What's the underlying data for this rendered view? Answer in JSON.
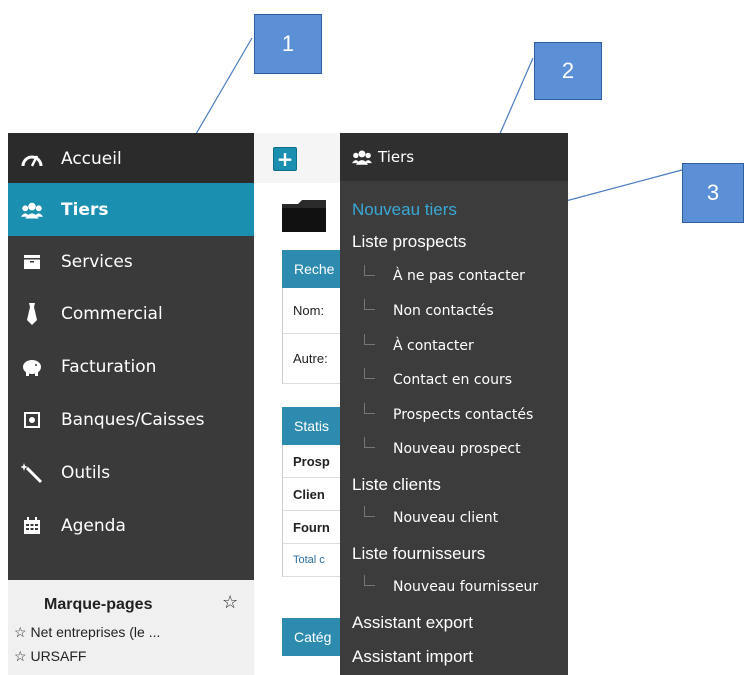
{
  "callouts": [
    "1",
    "2",
    "3"
  ],
  "sidebar": {
    "home": "Accueil",
    "items": [
      {
        "label": "Tiers",
        "icon": "users-icon",
        "active": true
      },
      {
        "label": "Services",
        "icon": "box-icon"
      },
      {
        "label": "Commercial",
        "icon": "tie-icon"
      },
      {
        "label": "Facturation",
        "icon": "piggy-bank-icon"
      },
      {
        "label": "Banques/Caisses",
        "icon": "safe-icon"
      },
      {
        "label": "Outils",
        "icon": "magic-wand-icon"
      },
      {
        "label": "Agenda",
        "icon": "calendar-icon"
      }
    ]
  },
  "bookmarks": {
    "title": "Marque-pages",
    "items": [
      "Net entreprises (le ...",
      "URSAFF"
    ]
  },
  "main": {
    "plus": "+",
    "search_head": "Reche",
    "row_nom": "Nom:",
    "row_autre": "Autre:",
    "stats_head": "Statis",
    "stats_rows": [
      "Prosp",
      "Clien",
      "Fourn",
      "Total c"
    ],
    "cat_head": "Catég"
  },
  "dropdown": {
    "header": "Tiers",
    "new_tiers": "Nouveau tiers",
    "prospects": "Liste prospects",
    "prospect_subs": [
      "À ne pas contacter",
      "Non contactés",
      "À contacter",
      "Contact en cours",
      "Prospects contactés",
      "Nouveau prospect"
    ],
    "clients": "Liste clients",
    "client_sub": "Nouveau client",
    "fournisseurs": "Liste fournisseurs",
    "fournisseur_sub": "Nouveau fournisseur",
    "export": "Assistant export",
    "import": "Assistant import"
  },
  "colors": {
    "accent": "#1b8fb0",
    "link": "#39a8d6",
    "sidebar": "#3a3a3a",
    "callout": "#5b8fd6"
  }
}
